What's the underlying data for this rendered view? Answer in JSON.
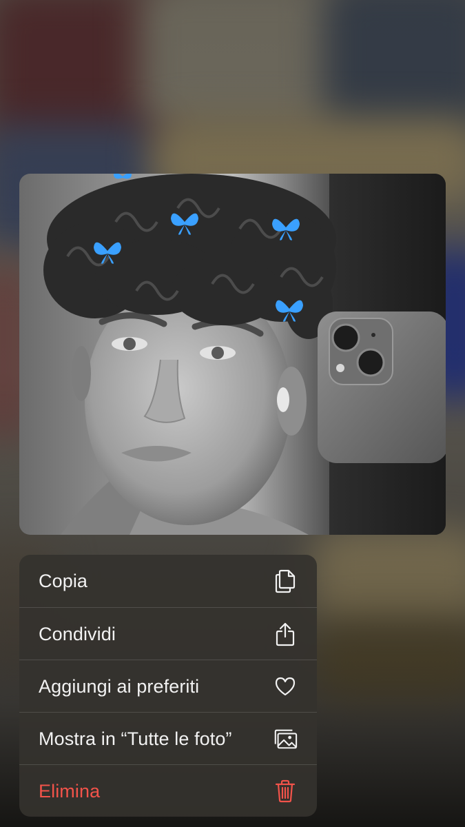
{
  "background": {
    "description_colors": [
      "#6b1f25",
      "#3b4a66",
      "#8a7a55",
      "#1f2f6b",
      "#b08a3a"
    ]
  },
  "preview": {
    "decoration_icon": "butterfly-icon",
    "decoration_color": "#3aa0ff"
  },
  "menu": {
    "items": [
      {
        "label": "Copia",
        "icon": "copy-icon"
      },
      {
        "label": "Condividi",
        "icon": "share-icon"
      },
      {
        "label": "Aggiungi ai preferiti",
        "icon": "heart-icon"
      },
      {
        "label": "Mostra in “Tutte le foto”",
        "icon": "photo-library-icon"
      },
      {
        "label": "Elimina",
        "icon": "trash-icon",
        "color": "#f2534a"
      }
    ]
  }
}
